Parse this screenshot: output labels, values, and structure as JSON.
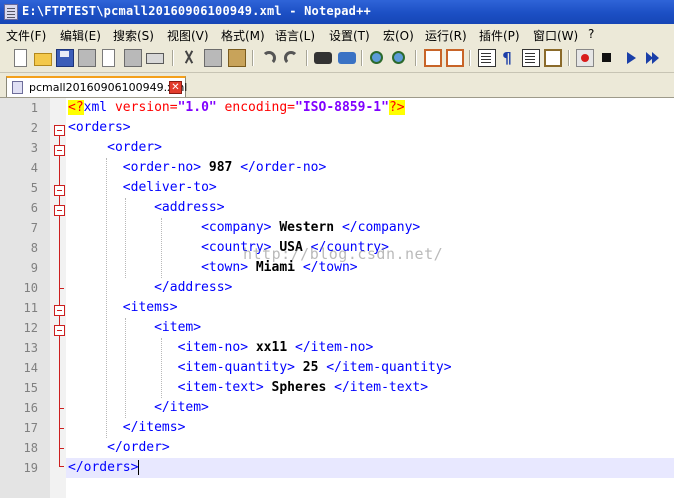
{
  "window": {
    "title": "E:\\FTPTEST\\pcmall20160906100949.xml - Notepad++"
  },
  "menu": [
    {
      "label": "文件(F)"
    },
    {
      "label": "编辑(E)"
    },
    {
      "label": "搜索(S)"
    },
    {
      "label": "视图(V)"
    },
    {
      "label": "格式(M)"
    },
    {
      "label": "语言(L)"
    },
    {
      "label": "设置(T)"
    },
    {
      "label": "宏(O)"
    },
    {
      "label": "运行(R)"
    },
    {
      "label": "插件(P)"
    },
    {
      "label": "窗口(W)"
    },
    {
      "label": "?"
    }
  ],
  "toolbar": {
    "icons": [
      "new-file-icon",
      "open-file-icon",
      "save-icon",
      "save-all-icon",
      "close-icon",
      "close-all-icon",
      "print-icon",
      "cut-icon",
      "copy-icon",
      "paste-icon",
      "undo-icon",
      "redo-icon",
      "find-icon",
      "replace-icon",
      "zoom-in-icon",
      "zoom-out-icon",
      "sync-vertical-icon",
      "sync-horizontal-icon",
      "word-wrap-icon",
      "show-all-chars-icon",
      "indent-guide-icon",
      "doc-map-icon",
      "record-macro-icon",
      "stop-macro-icon",
      "play-macro-icon",
      "run-macro-multiple-icon"
    ],
    "pilcrow": "¶"
  },
  "tab": {
    "label": "pcmall20160906100949.xml",
    "close_glyph": "✕"
  },
  "editor": {
    "watermark": "http://blog.csdn.net/",
    "lines": [
      {
        "num": "1",
        "ind": "",
        "parts": [
          {
            "t": "<?",
            "c": "pi"
          },
          {
            "t": "xml ",
            "c": "tag"
          },
          {
            "t": "version=",
            "c": "attr"
          },
          {
            "t": "\"1.0\"",
            "c": "val"
          },
          {
            "t": " encoding=",
            "c": "attr"
          },
          {
            "t": "\"ISO-8859-1\"",
            "c": "val"
          },
          {
            "t": "?>",
            "c": "pi"
          }
        ]
      },
      {
        "num": "2",
        "ind": "",
        "parts": [
          {
            "t": "<orders>",
            "c": "tag"
          }
        ]
      },
      {
        "num": "3",
        "ind": "     ",
        "parts": [
          {
            "t": "<order>",
            "c": "tag"
          }
        ]
      },
      {
        "num": "4",
        "ind": "       ",
        "parts": [
          {
            "t": "<order-no>",
            "c": "tag"
          },
          {
            "t": " 987 ",
            "c": "txt"
          },
          {
            "t": "</order-no>",
            "c": "tag"
          }
        ]
      },
      {
        "num": "5",
        "ind": "       ",
        "parts": [
          {
            "t": "<deliver-to>",
            "c": "tag"
          }
        ]
      },
      {
        "num": "6",
        "ind": "           ",
        "parts": [
          {
            "t": "<address>",
            "c": "tag"
          }
        ]
      },
      {
        "num": "7",
        "ind": "                 ",
        "parts": [
          {
            "t": "<company>",
            "c": "tag"
          },
          {
            "t": " Western ",
            "c": "txt"
          },
          {
            "t": "</company>",
            "c": "tag"
          }
        ]
      },
      {
        "num": "8",
        "ind": "                 ",
        "parts": [
          {
            "t": "<country>",
            "c": "tag"
          },
          {
            "t": " USA ",
            "c": "txt"
          },
          {
            "t": "</country>",
            "c": "tag"
          }
        ]
      },
      {
        "num": "9",
        "ind": "                 ",
        "parts": [
          {
            "t": "<town>",
            "c": "tag"
          },
          {
            "t": " Miami ",
            "c": "txt"
          },
          {
            "t": "</town>",
            "c": "tag"
          }
        ]
      },
      {
        "num": "10",
        "ind": "           ",
        "parts": [
          {
            "t": "</address>",
            "c": "tag"
          }
        ]
      },
      {
        "num": "11",
        "ind": "       ",
        "parts": [
          {
            "t": "<items>",
            "c": "tag"
          }
        ]
      },
      {
        "num": "12",
        "ind": "           ",
        "parts": [
          {
            "t": "<item>",
            "c": "tag"
          }
        ]
      },
      {
        "num": "13",
        "ind": "              ",
        "parts": [
          {
            "t": "<item-no>",
            "c": "tag"
          },
          {
            "t": " xx11 ",
            "c": "txt"
          },
          {
            "t": "</item-no>",
            "c": "tag"
          }
        ]
      },
      {
        "num": "14",
        "ind": "              ",
        "parts": [
          {
            "t": "<item-quantity>",
            "c": "tag"
          },
          {
            "t": " 25 ",
            "c": "txt"
          },
          {
            "t": "</item-quantity>",
            "c": "tag"
          }
        ]
      },
      {
        "num": "15",
        "ind": "              ",
        "parts": [
          {
            "t": "<item-text>",
            "c": "tag"
          },
          {
            "t": " Spheres ",
            "c": "txt"
          },
          {
            "t": "</item-text>",
            "c": "tag"
          }
        ]
      },
      {
        "num": "16",
        "ind": "           ",
        "parts": [
          {
            "t": "</item>",
            "c": "tag"
          }
        ]
      },
      {
        "num": "17",
        "ind": "       ",
        "parts": [
          {
            "t": "</items>",
            "c": "tag"
          }
        ]
      },
      {
        "num": "18",
        "ind": "     ",
        "parts": [
          {
            "t": "</order>",
            "c": "tag"
          }
        ]
      },
      {
        "num": "19",
        "ind": "",
        "parts": [
          {
            "t": "</orders>",
            "c": "tag"
          }
        ]
      }
    ]
  }
}
